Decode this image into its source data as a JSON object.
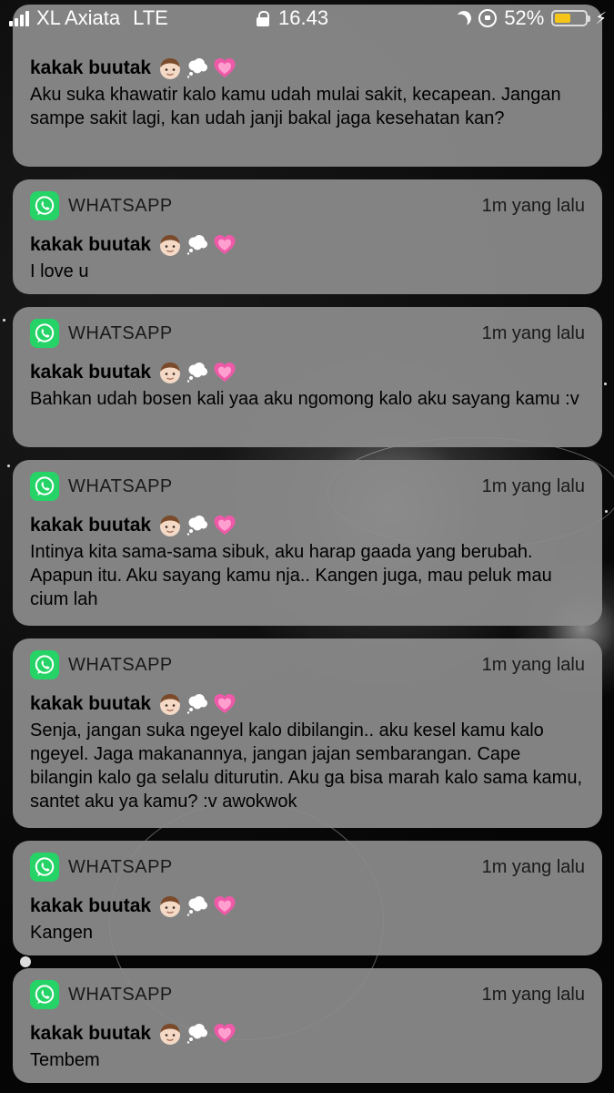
{
  "status_bar": {
    "carrier": "XL Axiata",
    "network": "LTE",
    "time": "16.43",
    "battery": "52%",
    "battery_level": 0.52,
    "icons": [
      "signal-icon",
      "lock-icon",
      "moon-icon",
      "rotation-lock-icon",
      "battery-icon",
      "charging-icon"
    ]
  },
  "colors": {
    "notification_bg": "#8c8c8c",
    "whatsapp_green": "#25d366",
    "battery_fill": "#f5c518"
  },
  "notifications": [
    {
      "sender": "kakak buutak",
      "message": "Aku suka khawatir kalo kamu udah mulai sakit, kecapean. Jangan sampe sakit lagi, kan udah janji bakal jaga kesehatan kan?"
    },
    {
      "app": "WHATSAPP",
      "time": "1m yang lalu",
      "sender": "kakak buutak",
      "message": "I love u"
    },
    {
      "app": "WHATSAPP",
      "time": "1m yang lalu",
      "sender": "kakak buutak",
      "message": "Bahkan udah bosen kali yaa aku ngomong kalo aku sayang kamu :v"
    },
    {
      "app": "WHATSAPP",
      "time": "1m yang lalu",
      "sender": "kakak buutak",
      "message": "Intinya kita sama-sama sibuk, aku harap gaada yang berubah. Apapun itu. Aku sayang kamu nja.. Kangen juga, mau peluk mau cium lah"
    },
    {
      "app": "WHATSAPP",
      "time": "1m yang lalu",
      "sender": "kakak buutak",
      "message": "Senja, jangan suka ngeyel kalo dibilangin.. aku kesel kamu kalo ngeyel. Jaga makanannya, jangan jajan sembarangan. Cape bilangin kalo ga selalu diturutin. Aku ga bisa marah kalo sama kamu, santet aku ya kamu? :v awokwok"
    },
    {
      "app": "WHATSAPP",
      "time": "1m yang lalu",
      "sender": "kakak buutak",
      "message": "Kangen"
    },
    {
      "app": "WHATSAPP",
      "time": "1m yang lalu",
      "sender": "kakak buutak",
      "message": "Tembem"
    }
  ]
}
